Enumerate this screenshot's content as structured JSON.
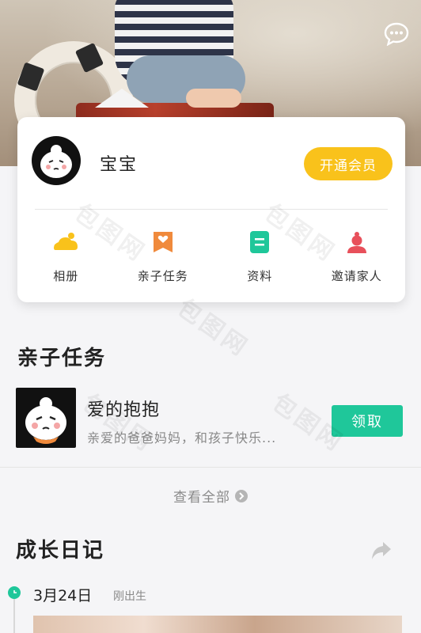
{
  "profile": {
    "name": "宝宝",
    "vip_label": "开通会员"
  },
  "menu": [
    {
      "label": "相册",
      "icon": "album-icon",
      "color": "#f9c21b"
    },
    {
      "label": "亲子任务",
      "icon": "task-heart-icon",
      "color": "#f08a3c"
    },
    {
      "label": "资料",
      "icon": "profile-doc-icon",
      "color": "#1fc79a"
    },
    {
      "label": "邀请家人",
      "icon": "invite-person-icon",
      "color": "#e8505b"
    }
  ],
  "tasks": {
    "title": "亲子任务",
    "item": {
      "name": "爱的抱抱",
      "description": "亲爱的爸爸妈妈，和孩子快乐...",
      "action_label": "领取"
    },
    "view_all_label": "查看全部"
  },
  "diary": {
    "title": "成长日记",
    "entry": {
      "date": "3月24日",
      "age_label": "刚出生"
    }
  },
  "watermark": "包图网",
  "colors": {
    "accent_yellow": "#f9c21b",
    "accent_green": "#1fc79a"
  }
}
